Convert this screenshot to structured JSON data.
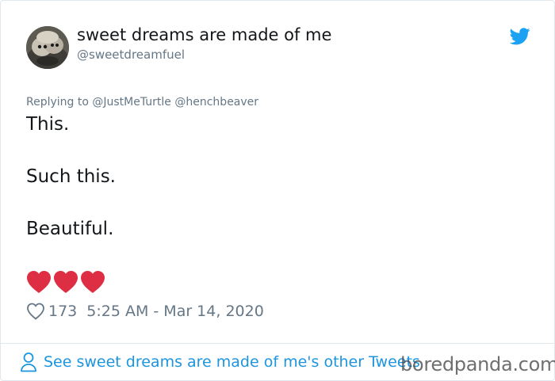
{
  "tweet": {
    "display_name": "sweet dreams are made of me",
    "handle": "@sweetdreamfuel",
    "reply": {
      "prefix": "Replying to",
      "mentions": [
        "@JustMeTurtle",
        "@henchbeaver"
      ]
    },
    "lines": [
      "This.",
      "Such this.",
      "Beautiful."
    ],
    "emoji": [
      "red-heart",
      "red-heart",
      "red-heart"
    ],
    "like_count": "173",
    "timestamp": "5:25 AM - Mar 14, 2020",
    "footer_link": "See sweet dreams are made of me's other Tweets"
  },
  "icons": {
    "brand": "twitter-bird-icon",
    "like": "heart-outline-icon",
    "profile": "person-icon"
  },
  "watermark": "boredpanda.com",
  "colors": {
    "twitter_blue": "#1da1f2",
    "link_blue": "#1b95e0",
    "secondary_text": "#657786",
    "primary_text": "#14171a",
    "heart_red": "#dd2e44",
    "border": "#e1e8ed"
  }
}
